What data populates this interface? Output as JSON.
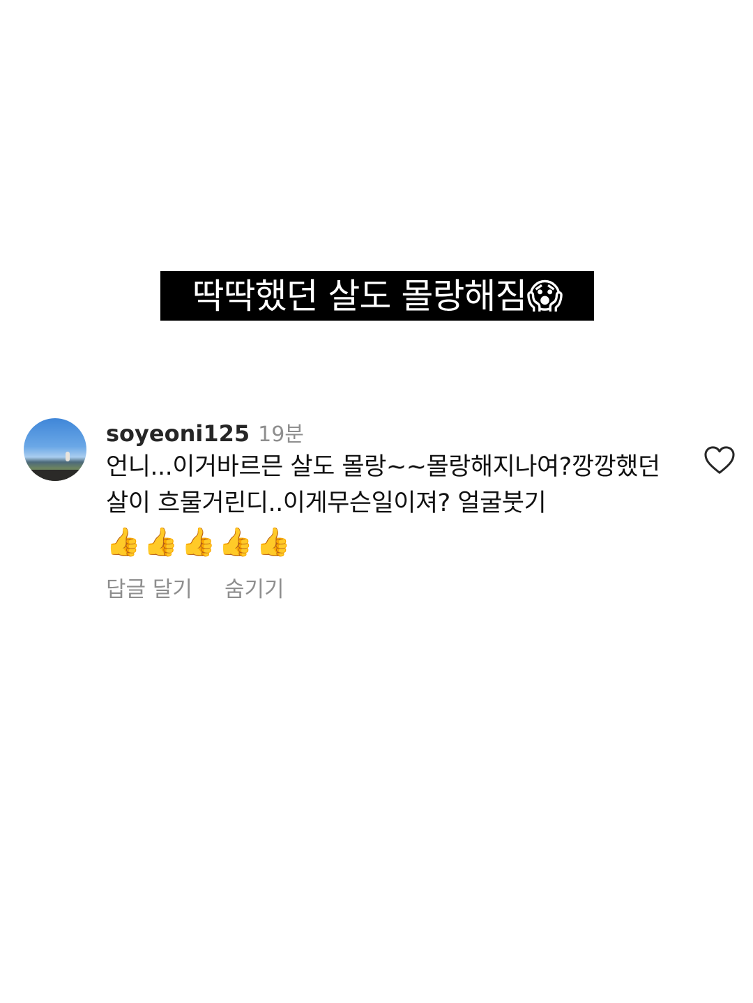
{
  "caption": {
    "text": "딱딱했던 살도 몰랑해짐😱"
  },
  "comment": {
    "username": "soyeoni125",
    "timestamp": "19분",
    "text": "언니...이거바르믄 살도 몰랑~~몰랑해지나여?깡깡했던살이 흐물거린디..이게무슨일이져? 얼굴붓기",
    "emojis": "👍👍👍👍👍",
    "actions": {
      "reply": "답글 달기",
      "hide": "숨기기"
    },
    "like_icon": "heart-outline-icon",
    "avatar": "profile-photo-sky-landscape"
  },
  "colors": {
    "caption_bg": "#000000",
    "caption_text": "#ffffff",
    "secondary_text": "#8e8e8e",
    "username_text": "#262626"
  }
}
